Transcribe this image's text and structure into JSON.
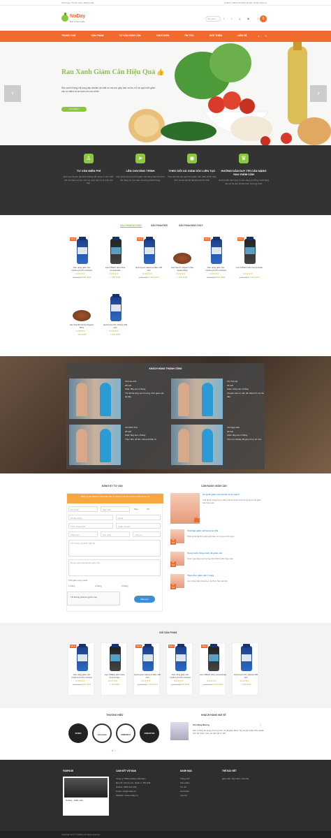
{
  "topbar": {
    "left": "Giỏ hàng | Thanh toán | Đăng nhập",
    "right": "Hotline: 0909 123 456 | Email: info@noday.vn"
  },
  "header": {
    "brand": "NoDay",
    "brand_sub": "Bạn & Sức khỏe",
    "search_placeholder": "Tìm kiếm",
    "cart_count": "0"
  },
  "nav": {
    "items": [
      "TRANG CHỦ",
      "SẢN PHẨM",
      "TƯ VẤN GIẢM CÂN",
      "THỰC ĐƠN",
      "TIN TỨC",
      "GIỚI THIỆU",
      "LIÊN HỆ"
    ]
  },
  "hero": {
    "title": "Rau Xanh Giảm Cân Hiệu Quả",
    "desc": "Rau xanh không chỉ cung cấp vitamin và chất xơ mà còn giúp bạn no lâu, hỗ trợ quá trình giảm cân tự nhiên và an toàn cho sức khỏe.",
    "button": "Xem thêm"
  },
  "features": [
    {
      "icon": "user-doctor-icon",
      "title": "TƯ VẤN MIỄN PHÍ",
      "desc": "Đội ngũ chuyên gia dinh dưỡng sẵn sàng tư vấn miễn phí cho bạn mọi lúc mọi nơi, giúp bạn có lộ trình phù hợp."
    },
    {
      "icon": "paper-plane-icon",
      "title": "LÊN CHƯƠNG TRÌNH",
      "desc": "Xây dựng chương trình giảm cân riêng biệt dựa trên thể trạng và mục tiêu của từng khách hàng."
    },
    {
      "icon": "rss-icon",
      "title": "THEO DÕI XÁ GIẢM SÓC LIÊN TỤC",
      "desc": "Theo dõi sát sao quá trình giảm cân, điều chỉnh thực đơn và bài tập để đạt kết quả tốt nhất."
    },
    {
      "icon": "trophy-icon",
      "title": "HƯỚNG DẪN DUY TRÌ CÂN NẶNG SAU GIẢM CÂN",
      "desc": "Hướng dẫn cách duy trì cân nặng lý tưởng, tránh tăng cân trở lại sau khi kết thúc chương trình."
    }
  ],
  "tabs": [
    "SẢN PHẨM NỔI BẬT",
    "SẢN PHẨM MỚI",
    "SẢN PHẨM BÁN CHẠY"
  ],
  "products": [
    {
      "name": "Viên uống giảm cân Hydroxycut Pro Clinical",
      "old": "1.200.000đ",
      "price": "980.000đ",
      "style": "blue"
    },
    {
      "name": "Lipo 6 Black Hers Ultra Concentrate",
      "old": "",
      "price": "1.150.000đ",
      "style": "dark"
    },
    {
      "name": "Hydroxycut Hardcore Elite 100 viên",
      "old": "1.300.000đ",
      "price": "1.050.000đ",
      "style": "blue"
    },
    {
      "name": "Hạt chia Úc Organic Chia Seeds 500g",
      "old": "",
      "price": "1.200.000đ",
      "style": "seeds"
    },
    {
      "name": "Viên uống giảm cân Hydroxycut Pro Clinical",
      "old": "1.200.000đ",
      "price": "990.000đ",
      "style": "blue"
    },
    {
      "name": "Lipo 6 Black Ultra Concentrate",
      "old": "1.400.000đ",
      "price": "1.100.000đ",
      "style": "dark"
    },
    {
      "name": "Hạt chia Mỹ Nutiva Organic 907g",
      "old": "",
      "price": "450.000đ",
      "style": "seeds"
    },
    {
      "name": "Hydroxycut Pro Clinical 150 viên",
      "old": "",
      "price": "1.200.000đ",
      "style": "blue"
    }
  ],
  "testimonials": {
    "title": "KHÁCH HÀNG THÀNH CÔNG",
    "items": [
      {
        "name": "Chị Lan Anh",
        "age": "28 tuổi",
        "result": "Giảm 8kg sau 2 tháng",
        "quote": "Tôi rất hài lòng với chương trình giảm cân tại đây."
      },
      {
        "name": "Chị Thu Hà",
        "age": "32 tuổi",
        "result": "Giảm 10kg sau 3 tháng",
        "quote": "Chuyên viên tư vấn rất nhiệt tình và chu đáo."
      },
      {
        "name": "Chị Minh Thư",
        "age": "25 tuổi",
        "result": "Giảm 6kg sau 1 tháng",
        "quote": "Thực đơn dễ làm, kết quả thấy rõ."
      },
      {
        "name": "Chị Ngọc Mai",
        "age": "30 tuổi",
        "result": "Giảm 9kg sau 2 tháng",
        "quote": "Cảm ơn NoDay đã giúp tôi tự tin hơn."
      }
    ]
  },
  "register": {
    "title": "ĐĂNG KÝ TƯ VẤN",
    "header": "Đăng ký để nhận tư vấn miễn phí từ chuyên gia dinh dưỡng của chúng tôi",
    "fields": [
      "Họ và tên",
      "Năm sinh",
      "Số điện thoại",
      "Email",
      "Tỉnh / Thành phố",
      "Quận / Huyện",
      "Chiều cao",
      "Cân nặng",
      "Vòng eo"
    ],
    "gender": [
      "Nam",
      "Nữ"
    ],
    "textarea1": "Tình trạng sức khỏe hiện tại",
    "textarea2": "Mong muốn của bạn khi giảm cân",
    "plan_label": "Thời gian mong muốn",
    "plans": [
      "1 tháng",
      "2 tháng",
      "3 tháng"
    ],
    "captcha": "Tôi không phải là người máy",
    "submit": "Đăng ký"
  },
  "news": {
    "title": "CẨM NANG GIẢM CÂN",
    "items": [
      {
        "date": "11 Th8",
        "title": "Ăn gì để giảm cân nhanh và an toàn?",
        "excerpt": "Chế độ ăn uống hợp lý đóng vai trò quan trọng trong quá trình giảm cân hiệu quả."
      },
      {
        "date": "08 Th8",
        "title": "5 bài tập giảm mỡ bụng tại nhà",
        "excerpt": "Những bài tập đơn giản giúp bạn có vòng eo thon gọn."
      },
      {
        "date": "05 Th8",
        "title": "Uống nước đúng cách để giảm cân",
        "excerpt": "Nước giúp tăng cường trao đổi chất và đốt cháy calo."
      },
      {
        "date": "02 Th8",
        "title": "Thực đơn giảm cân 7 ngày",
        "excerpt": "Gợi ý thực đơn khoa học, dễ thực hiện tại nhà."
      }
    ]
  },
  "packages": {
    "title": "GÓI SẢN PHẨM"
  },
  "brands": {
    "title": "THƯƠNG HIỆU",
    "items": [
      "SOMA",
      "Acountai",
      "AMERICA",
      "CREATIVE"
    ]
  },
  "testimonial_side": {
    "title": "KHÁCH HÀNG NÓI VỀ",
    "name": "Chị Hồng Nhung",
    "quote": "Sau 2 tháng áp dụng chương trình, tôi đã giảm được 7kg và cảm thấy khỏe khoắn hơn rất nhiều. Cảm ơn đội ngũ tư vấn!"
  },
  "footer": {
    "fanpage": "FANPAGE",
    "fanpage_name": "NoDay - Giảm cân",
    "contact_title": "CAM KẾT VỚI BẠN",
    "contact": [
      "Công ty TNHH NoDay Việt Nam",
      "Địa chỉ: 123 Lê Lợi, Quận 1, TP.HCM",
      "Hotline: 0909 123 456",
      "Email: info@noday.vn",
      "Website: www.noday.vn"
    ],
    "links_title": "DANH MỤC",
    "links": [
      "Trang chủ",
      "Sản phẩm",
      "Tin tức",
      "Giới thiệu",
      "Liên hệ"
    ],
    "tags_title": "THẺ BÀI VIẾT",
    "tags": "giảm cân, thực đơn, hạt chia"
  },
  "copyright": "Copyright 2017 © NoDay. All rights reserved."
}
